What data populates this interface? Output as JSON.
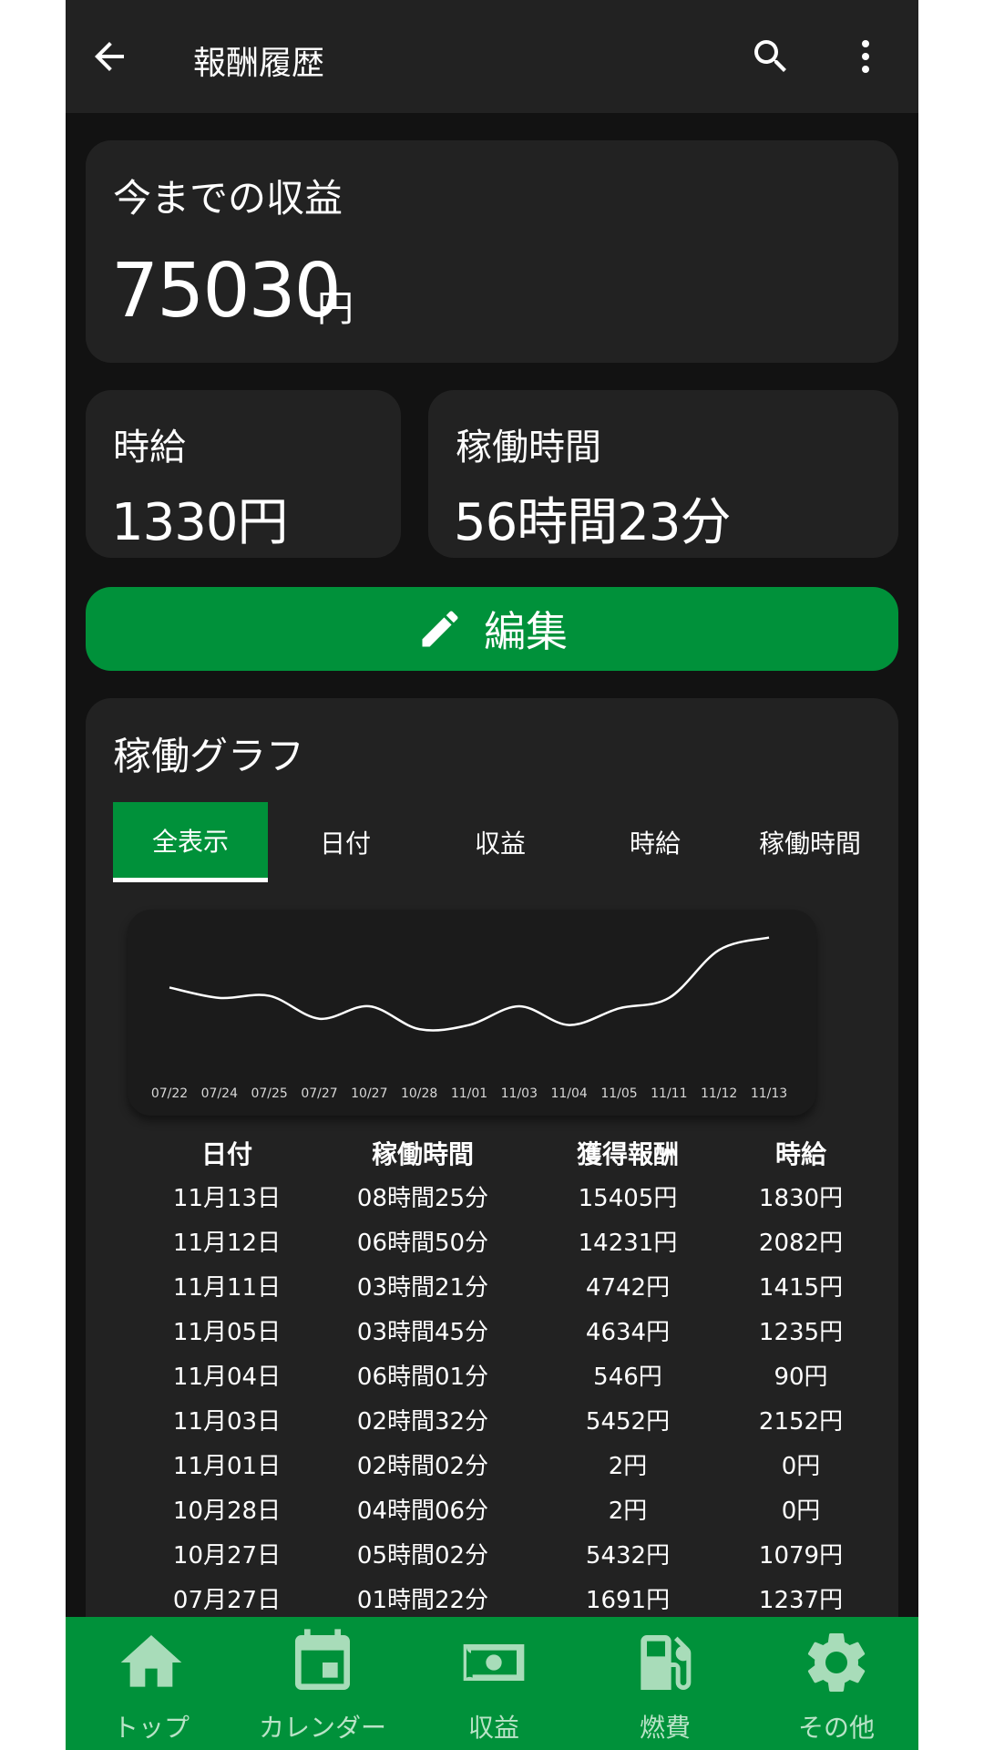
{
  "app_bar": {
    "title": "報酬履歴"
  },
  "earnings": {
    "label": "今までの収益",
    "value": "75030",
    "unit": "円"
  },
  "hourly_wage": {
    "label": "時給",
    "value": "1330円"
  },
  "work_hours": {
    "label": "稼働時間",
    "value": "56時間23分"
  },
  "edit_button": {
    "label": "編集"
  },
  "graph": {
    "title": "稼働グラフ",
    "tabs": [
      "全表示",
      "日付",
      "収益",
      "時給",
      "稼働時間"
    ],
    "active_tab": 0
  },
  "chart_data": {
    "type": "line",
    "categories": [
      "07/22",
      "07/24",
      "07/25",
      "07/27",
      "10/27",
      "10/28",
      "11/01",
      "11/03",
      "11/04",
      "11/05",
      "11/11",
      "11/12",
      "11/13"
    ],
    "values": [
      3.7,
      3.2,
      3.3,
      2.2,
      2.8,
      1.7,
      1.9,
      2.8,
      1.9,
      2.7,
      3.2,
      5.5,
      6.1
    ],
    "ylim": [
      0,
      7
    ],
    "grid": false,
    "colors": {
      "line": "#ffffff"
    }
  },
  "table": {
    "headers": [
      "日付",
      "稼働時間",
      "獲得報酬",
      "時給"
    ],
    "rows": [
      [
        "11月13日",
        "08時間25分",
        "15405円",
        "1830円"
      ],
      [
        "11月12日",
        "06時間50分",
        "14231円",
        "2082円"
      ],
      [
        "11月11日",
        "03時間21分",
        "4742円",
        "1415円"
      ],
      [
        "11月05日",
        "03時間45分",
        "4634円",
        "1235円"
      ],
      [
        "11月04日",
        "06時間01分",
        "546円",
        "90円"
      ],
      [
        "11月03日",
        "02時間32分",
        "5452円",
        "2152円"
      ],
      [
        "11月01日",
        "02時間02分",
        "2円",
        "0円"
      ],
      [
        "10月28日",
        "04時間06分",
        "2円",
        "0円"
      ],
      [
        "10月27日",
        "05時間02分",
        "5432円",
        "1079円"
      ],
      [
        "07月27日",
        "01時間22分",
        "1691円",
        "1237円"
      ]
    ]
  },
  "bottom_nav": [
    {
      "label": "トップ",
      "icon": "home-icon"
    },
    {
      "label": "カレンダー",
      "icon": "calendar-icon"
    },
    {
      "label": "収益",
      "icon": "money-icon"
    },
    {
      "label": "燃費",
      "icon": "fuel-icon"
    },
    {
      "label": "その他",
      "icon": "gear-icon"
    }
  ],
  "colors": {
    "accent": "#00913a",
    "background": "#121212",
    "surface": "#222222"
  }
}
